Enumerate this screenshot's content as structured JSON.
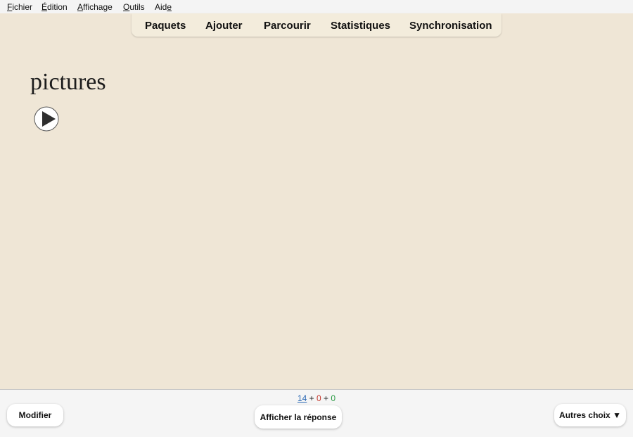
{
  "menu": [
    {
      "label_pre": "",
      "label_u": "F",
      "label_post": "ichier"
    },
    {
      "label_pre": "",
      "label_u": "É",
      "label_post": "dition"
    },
    {
      "label_pre": "",
      "label_u": "A",
      "label_post": "ffichage"
    },
    {
      "label_pre": "",
      "label_u": "O",
      "label_post": "utils"
    },
    {
      "label_pre": "Aid",
      "label_u": "e",
      "label_post": ""
    }
  ],
  "tabs": [
    "Paquets",
    "Ajouter",
    "Parcourir",
    "Statistiques",
    "Synchronisation"
  ],
  "card": {
    "text": "pictures",
    "audio_icon": "play-icon"
  },
  "counts": {
    "new": "14",
    "sep1": " + ",
    "learn": "0",
    "sep2": " + ",
    "review": "0"
  },
  "buttons": {
    "edit": "Modifier",
    "show_answer": "Afficher la réponse",
    "more": "Autres choix ▼"
  },
  "colors": {
    "background": "#efe6d6",
    "new": "#2d6ab5",
    "learn": "#c5372c",
    "review": "#2a9a43"
  }
}
